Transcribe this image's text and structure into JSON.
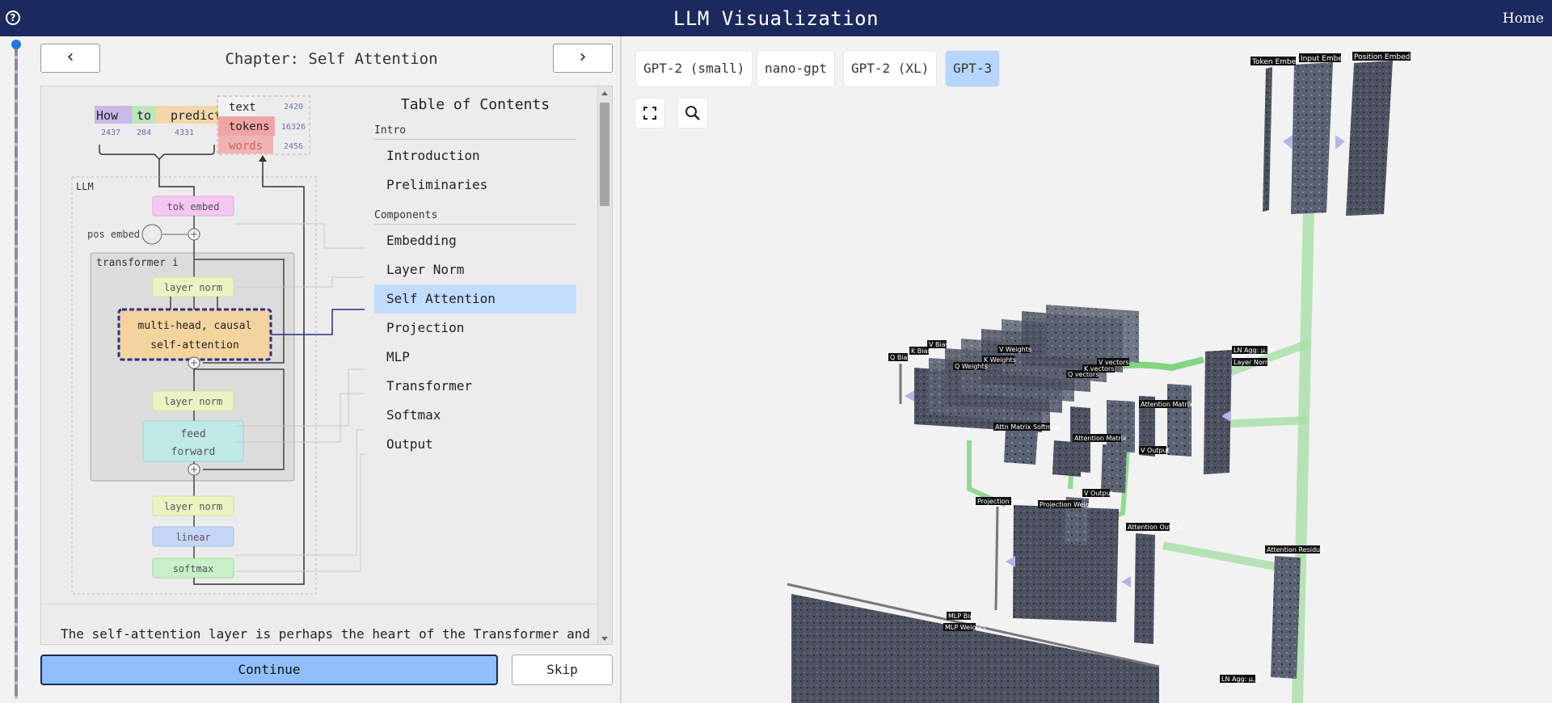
{
  "header": {
    "title": "LLM Visualization",
    "home": "Home",
    "help": "?"
  },
  "left": {
    "chapter": "Chapter: Self Attention",
    "prev": "‹",
    "next": "›",
    "diagram": {
      "tokens": [
        "How",
        "to",
        "predict"
      ],
      "token_ids": [
        "2437",
        "284",
        "4331"
      ],
      "legend": [
        {
          "label": "text",
          "count": "2420"
        },
        {
          "label": "tokens",
          "count": "16326"
        },
        {
          "label": "words",
          "count": "2456"
        }
      ],
      "llm": "LLM",
      "tok_embed": "tok embed",
      "pos_embed": "pos embed",
      "transformer": "transformer i",
      "layer_norm_1": "layer norm",
      "attn_line1": "multi-head, causal",
      "attn_line2": "self-attention",
      "layer_norm_2": "layer norm",
      "ff_line1": "feed",
      "ff_line2": "forward",
      "layer_norm_3": "layer norm",
      "linear": "linear",
      "softmax": "softmax"
    },
    "toc": {
      "title": "Table of Contents",
      "sections": [
        {
          "name": "Intro",
          "items": [
            "Introduction",
            "Preliminaries"
          ]
        },
        {
          "name": "Components",
          "items": [
            "Embedding",
            "Layer Norm",
            "Self Attention",
            "Projection",
            "MLP",
            "Transformer",
            "Softmax",
            "Output"
          ]
        }
      ],
      "active": "Self Attention"
    },
    "paragraph": "The self-attention layer is perhaps the heart of the Transformer and",
    "continue": "Continue",
    "skip": "Skip"
  },
  "view": {
    "models": [
      "GPT-2 (small)",
      "nano-gpt",
      "GPT-2 (XL)",
      "GPT-3"
    ],
    "active_model": "GPT-3",
    "tools": [
      "expand-icon",
      "search-icon"
    ],
    "labels": {
      "token_embed": "Token Embed",
      "input_embed": "Input Embed",
      "position_embed": "Position Embed",
      "q_bias": "Q Bias",
      "k_bias": "K Bias",
      "v_bias": "V Bias",
      "q_weights": "Q Weights",
      "k_weights": "K Weights",
      "v_weights": "V Weights",
      "q_vectors": "Q vectors",
      "k_vectors": "K vectors",
      "v_vectors": "V vectors",
      "attention_matrix": "Attention Matrix",
      "attn_matrix_softmax": "Attn Matrix Softmax",
      "v_output": "V Output",
      "projection_weights": "Projection Weights",
      "projection_bias": "Projection Bias",
      "attention_output": "Attention Output",
      "attention_residual": "Attention Residual",
      "layer_norm": "Layer Norm",
      "ln_agg": "LN Agg: μ, σ",
      "mlp_bias": "MLP Bias",
      "mlp_weights": "MLP Weights"
    }
  },
  "colors": {
    "header": "#1b2a5e",
    "continue": "#8fc0fb",
    "active_toc": "#c2dcff",
    "active_model": "#b6d6fb",
    "tensor": "#4d5160",
    "flow": "#9ad99a"
  }
}
